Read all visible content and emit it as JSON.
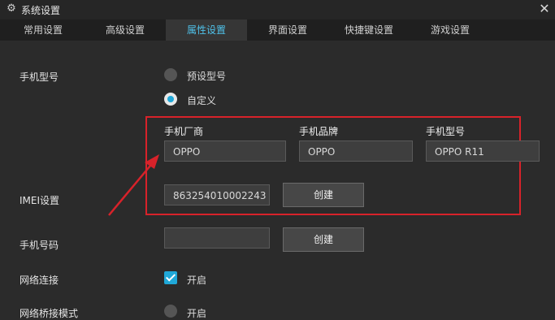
{
  "window": {
    "title": "系统设置",
    "close_symbol": "✕",
    "gear_symbol": "⚙"
  },
  "tabs": [
    {
      "label": "常用设置",
      "active": false
    },
    {
      "label": "高级设置",
      "active": false
    },
    {
      "label": "属性设置",
      "active": true
    },
    {
      "label": "界面设置",
      "active": false
    },
    {
      "label": "快捷键设置",
      "active": false
    },
    {
      "label": "游戏设置",
      "active": false
    }
  ],
  "phone_model": {
    "label": "手机型号",
    "options": [
      {
        "label": "预设型号",
        "selected": false
      },
      {
        "label": "自定义",
        "selected": true
      }
    ],
    "custom": {
      "manufacturer": {
        "label": "手机厂商",
        "value": "OPPO"
      },
      "brand": {
        "label": "手机品牌",
        "value": "OPPO"
      },
      "model": {
        "label": "手机型号",
        "value": "OPPO R11"
      }
    }
  },
  "imei": {
    "label": "IMEI设置",
    "value": "863254010002243",
    "button": "创建"
  },
  "phone_number": {
    "label": "手机号码",
    "value": "",
    "button": "创建"
  },
  "network": {
    "label": "网络连接",
    "checked": true,
    "option": "开启"
  },
  "bridge": {
    "label": "网络桥接模式",
    "selected": false,
    "option": "开启"
  },
  "accent_color": "#20a8d8",
  "highlight_color": "#d8222a"
}
